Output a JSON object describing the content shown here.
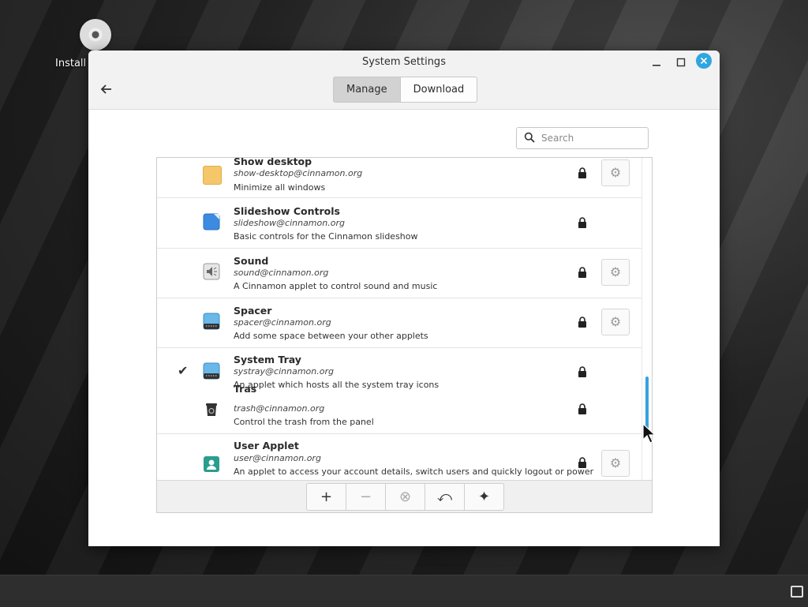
{
  "desktop": {
    "install_label": "Install"
  },
  "window": {
    "title": "System Settings",
    "tabs": [
      {
        "label": "Manage",
        "selected": true
      },
      {
        "label": "Download",
        "selected": false
      }
    ],
    "search": {
      "placeholder": "Search",
      "value": ""
    },
    "applets": [
      {
        "name": "Show desktop",
        "uuid": "show-desktop@cinnamon.org",
        "description": "Minimize all windows",
        "icon": "folder-icon",
        "locked": true,
        "configurable": true,
        "enabled": false
      },
      {
        "name": "Slideshow Controls",
        "uuid": "slideshow@cinnamon.org",
        "description": "Basic controls for the Cinnamon slideshow",
        "icon": "slideshow-icon",
        "locked": true,
        "configurable": false,
        "enabled": false
      },
      {
        "name": "Sound",
        "uuid": "sound@cinnamon.org",
        "description": "A Cinnamon applet to control sound and music",
        "icon": "speaker-icon",
        "locked": true,
        "configurable": true,
        "enabled": false
      },
      {
        "name": "Spacer",
        "uuid": "spacer@cinnamon.org",
        "description": "Add some space between your other applets",
        "icon": "panel-icon",
        "locked": true,
        "configurable": true,
        "enabled": false
      },
      {
        "name": "System Tray",
        "uuid": "systray@cinnamon.org",
        "description": "An applet which hosts all the system tray icons",
        "icon": "panel-icon",
        "locked": true,
        "configurable": false,
        "enabled": true
      },
      {
        "name": "Tras",
        "uuid": "trash@cinnamon.org",
        "description": "Control the trash from the panel",
        "icon": "trash-icon",
        "locked": true,
        "configurable": false,
        "enabled": false
      },
      {
        "name": "User Applet",
        "uuid": "user@cinnamon.org",
        "description": "An applet to access your account details, switch users and quickly logout or power",
        "icon": "user-icon",
        "locked": true,
        "configurable": true,
        "enabled": false
      }
    ],
    "toolbar": {
      "add": "+",
      "remove": "−",
      "uninstall": "⊗",
      "restore": "⤺",
      "extra": "✦"
    }
  },
  "colors": {
    "accent": "#35a3dd",
    "close_button": "#30a6e0"
  }
}
